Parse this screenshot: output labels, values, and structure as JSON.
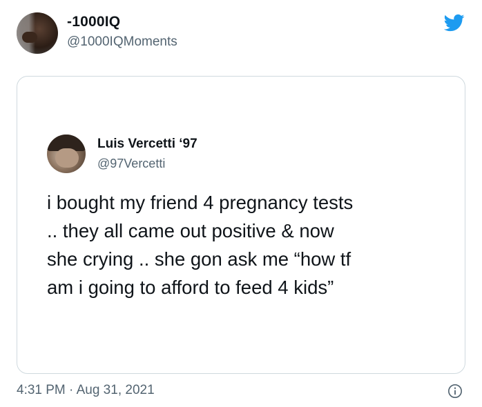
{
  "tweet": {
    "display_name": "-1000IQ",
    "handle": "@1000IQMoments",
    "timestamp": "4:31 PM · Aug 31, 2021"
  },
  "quoted": {
    "display_name": "Luis Vercetti ‘97",
    "handle": "@97Vercetti",
    "text": "i bought my friend 4 pregnancy tests\n.. they all came out positive & now\nshe crying .. she gon ask me “how tf\nam i going to afford to feed 4 kids”"
  },
  "icons": {
    "brand": "twitter-bird-icon",
    "info": "info-icon"
  },
  "colors": {
    "brand": "#1d9bf0",
    "secondary_text": "#536471",
    "border": "#cfd9de"
  }
}
